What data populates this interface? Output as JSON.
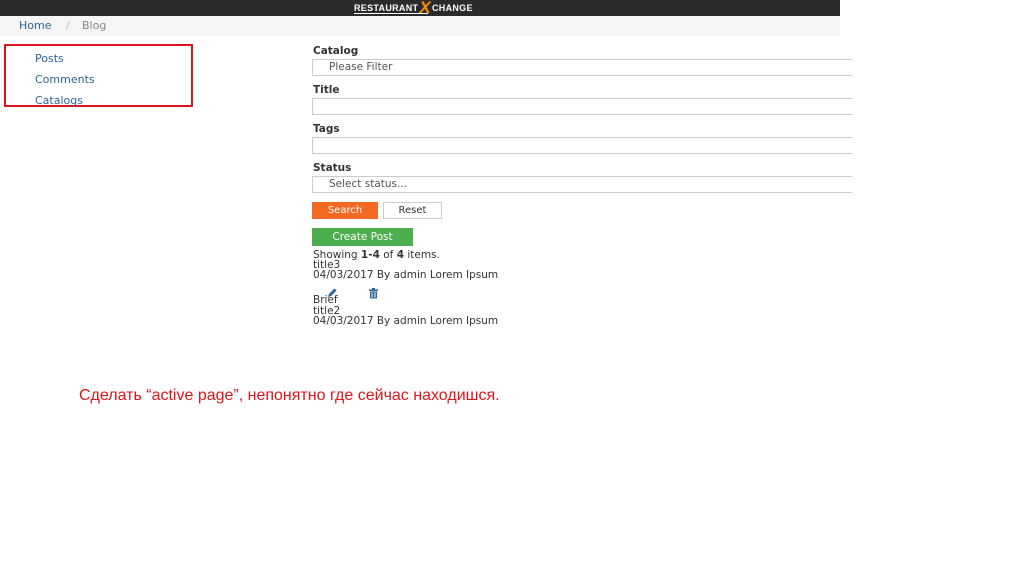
{
  "header": {
    "logo_left": "RESTAURANT",
    "logo_x": "X",
    "logo_right": "CHANGE",
    "bg_color": "#2b2b2b",
    "accent_color": "#f39200"
  },
  "breadcrumb": {
    "home": "Home",
    "separator": "/",
    "current": "Blog"
  },
  "sidebar": {
    "items": [
      {
        "label": "Posts"
      },
      {
        "label": "Comments"
      },
      {
        "label": "Catalogs"
      }
    ]
  },
  "filters": {
    "catalog_label": "Catalog",
    "catalog_value": "Please Filter",
    "title_label": "Title",
    "title_value": "",
    "tags_label": "Tags",
    "tags_value": "",
    "status_label": "Status",
    "status_value": "Select status..."
  },
  "buttons": {
    "search": "Search",
    "reset": "Reset",
    "create_post": "Create Post"
  },
  "summary": {
    "prefix": "Showing ",
    "range": "1-4",
    "middle": " of ",
    "total": "4",
    "suffix": " items."
  },
  "posts": [
    {
      "title": "title3",
      "meta": "04/03/2017 By admin Lorem Ipsum",
      "brief": "Brief"
    },
    {
      "title": "title2",
      "meta": "04/03/2017 By admin Lorem Ipsum"
    }
  ],
  "icons": {
    "edit": "pencil-icon",
    "delete": "trash-icon"
  },
  "annotation": {
    "text": "Сделать “active page”, непонятно где сейчас находишся.",
    "color": "#e0141b"
  }
}
